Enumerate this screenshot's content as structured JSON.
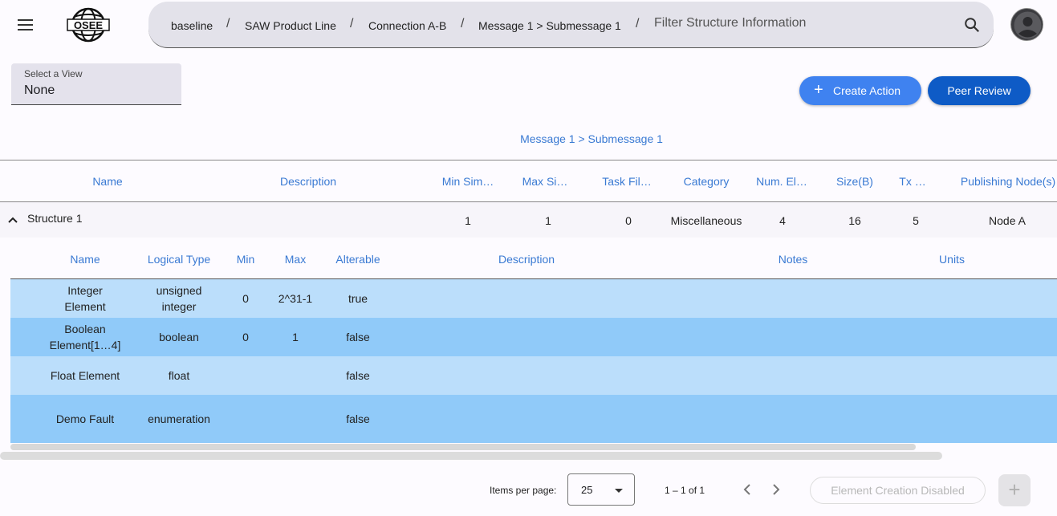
{
  "header": {
    "breadcrumbs": [
      "baseline",
      "SAW Product Line",
      "Connection A-B",
      "Message 1 > Submessage 1"
    ],
    "separator": "/",
    "filter_placeholder": "Filter Structure Information",
    "logo_text": "OSEE"
  },
  "view_select": {
    "label": "Select a View",
    "value": "None"
  },
  "actions": {
    "create_label": "Create Action",
    "create_icon": "+",
    "peer_review_label": "Peer Review"
  },
  "sub_title": "Message 1 > Submessage 1",
  "structure_table": {
    "headers": [
      "Name",
      "Description",
      "Min Sim…",
      "Max Si…",
      "Task Fil…",
      "Category",
      "Num. El…",
      "Size(B)",
      "Tx …",
      "Publishing Node(s)"
    ],
    "row": {
      "name": "Structure 1",
      "description": "",
      "min_sim": "1",
      "max_sim": "1",
      "task_file": "0",
      "category": "Miscellaneous",
      "num_elements": "4",
      "size": "16",
      "tx": "5",
      "publishing_node": "Node A"
    }
  },
  "element_table": {
    "headers": [
      "Name",
      "Logical Type",
      "Min",
      "Max",
      "Alterable",
      "Description",
      "Notes",
      "Units"
    ],
    "rows": [
      {
        "name": "Integer Element",
        "type": "unsigned integer",
        "min": "0",
        "max": "2^31-1",
        "alterable": "true"
      },
      {
        "name": "Boolean Element[1…4]",
        "type": "boolean",
        "min": "0",
        "max": "1",
        "alterable": "false"
      },
      {
        "name": "Float Element",
        "type": "float",
        "min": "",
        "max": "",
        "alterable": "false"
      },
      {
        "name": "Demo Fault",
        "type": "enumeration",
        "min": "",
        "max": "",
        "alterable": "false"
      }
    ]
  },
  "footer": {
    "items_per_page_label": "Items per page:",
    "items_per_page_value": "25",
    "range_label": "1 – 1 of 1",
    "element_creation_label": "Element Creation Disabled",
    "add_icon": "+"
  },
  "colors": {
    "accent": "#3f82f0",
    "peer": "#0e5bc6",
    "row_light": "#bbdefb",
    "row_dark": "#90caf9",
    "link": "#3a7ad3"
  }
}
